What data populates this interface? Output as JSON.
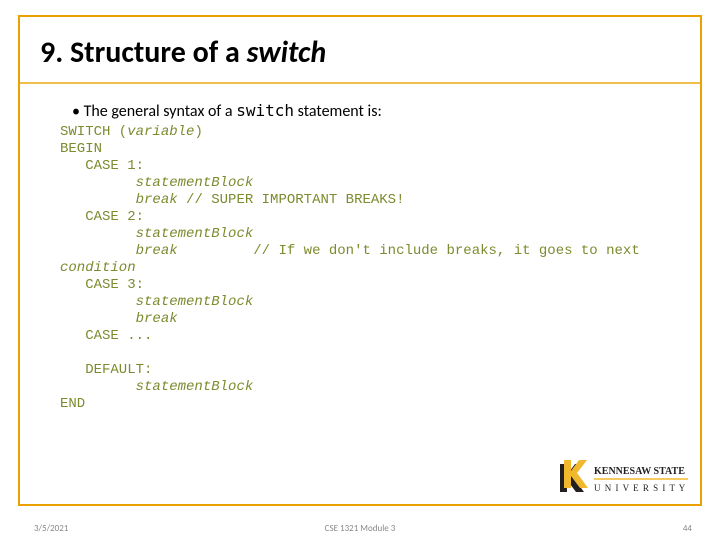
{
  "title_prefix": "9. Structure of a ",
  "title_keyword": "switch",
  "lead_bullet": "• The general syntax of a ",
  "lead_mono": "switch",
  "lead_tail": " statement is:",
  "code": {
    "l1": "SWITCH (",
    "l1_it": "variable",
    "l1_tail": ")",
    "l2": "BEGIN",
    "l3": "   CASE 1:",
    "l4": "         ",
    "l4_it": "statementBlock",
    "l5": "         ",
    "l5_it": "break",
    "l5_tail": " // SUPER IMPORTANT BREAKS!",
    "l6": "   CASE 2:",
    "l7": "         ",
    "l7_it": "statementBlock",
    "l8": "         ",
    "l8_it": "break",
    "l8_tail": "         // If we don't include breaks, it goes to next",
    "l9_it": "condition",
    "l10": "   CASE 3:",
    "l11": "         ",
    "l11_it": "statementBlock",
    "l12": "         ",
    "l12_it": "break",
    "l13": "   CASE ...",
    "l14": "",
    "l15": "   DEFAULT:",
    "l16": "         ",
    "l16_it": "statementBlock",
    "l17": "END"
  },
  "footer": {
    "date": "3/5/2021",
    "center": "CSE 1321 Module 3",
    "page": "44"
  },
  "logo": {
    "line1": "KENNESAW STATE",
    "line2": "U N I V E R S I T Y"
  }
}
